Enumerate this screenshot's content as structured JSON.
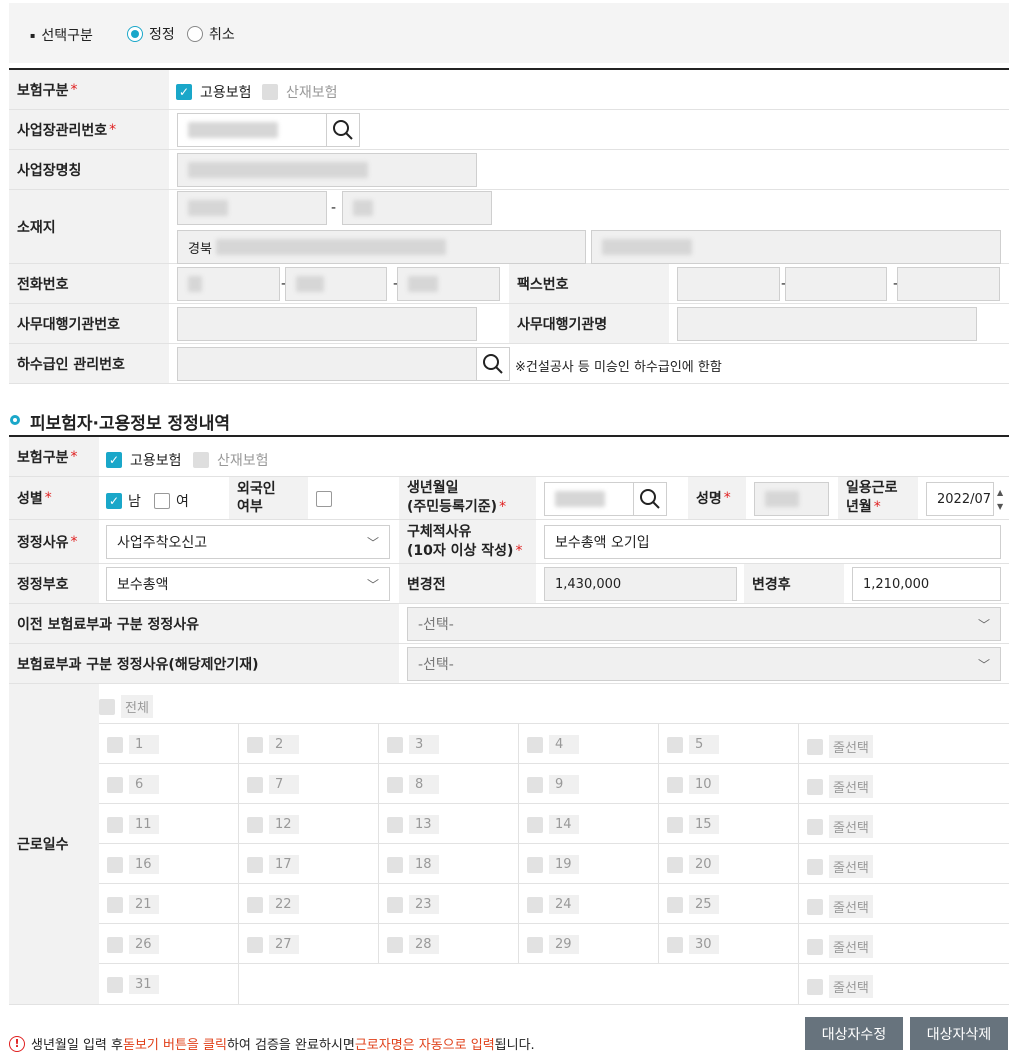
{
  "top": {
    "label": "선택구분",
    "options": [
      "정정",
      "취소"
    ],
    "selected": "정정"
  },
  "workplace": {
    "ins_type_label": "보험구분",
    "ins_options": [
      "고용보험",
      "산재보험"
    ],
    "mgmt_no_label": "사업장관리번호",
    "name_label": "사업장명칭",
    "addr_label": "소재지",
    "addr_prefix": "경북",
    "phone_label": "전화번호",
    "fax_label": "팩스번호",
    "agency_no_label": "사무대행기관번호",
    "agency_name_label": "사무대행기관명",
    "sub_no_label": "하수급인 관리번호",
    "sub_note": "※건설공사 등 미승인 하수급인에 한함"
  },
  "section_title": "피보험자·고용정보 정정내역",
  "insured": {
    "ins_type_label": "보험구분",
    "ins_options": [
      "고용보험",
      "산재보험"
    ],
    "gender_label": "성별",
    "gender_options": [
      "남",
      "여"
    ],
    "foreign_label": "외국인\n여부",
    "birth_label_1": "생년월일",
    "birth_label_2": "(주민등록기준)",
    "name_label": "성명",
    "daywork_label_1": "일용근로",
    "daywork_label_2": "년월",
    "daywork_value": "2022/07",
    "reason_label": "정정사유",
    "reason_value": "사업주착오신고",
    "detail_label_1": "구체적사유",
    "detail_label_2": "(10자 이상 작성)",
    "detail_value": "보수총액 오기입",
    "part_label": "정정부호",
    "part_value": "보수총액",
    "before_label": "변경전",
    "before_value": "1,430,000",
    "after_label": "변경후",
    "after_value": "1,210,000",
    "prev_reason_label": "이전 보험료부과 구분 정정사유",
    "prev_reason_value": "-선택-",
    "fee_reason_label": "보험료부과 구분 정정사유(해당제안기재)",
    "fee_reason_value": "-선택-",
    "workdays_label": "근로일수",
    "all_label": "전체",
    "row_select_label": "줄선택",
    "days": [
      [
        "1",
        "2",
        "3",
        "4",
        "5"
      ],
      [
        "6",
        "7",
        "8",
        "9",
        "10"
      ],
      [
        "11",
        "12",
        "13",
        "14",
        "15"
      ],
      [
        "16",
        "17",
        "18",
        "19",
        "20"
      ],
      [
        "21",
        "22",
        "23",
        "24",
        "25"
      ],
      [
        "26",
        "27",
        "28",
        "29",
        "30"
      ],
      [
        "31"
      ]
    ]
  },
  "footer": {
    "note_1": "생년월일 입력 후 ",
    "note_2": "돋보기 버튼을 클릭",
    "note_3": "하여 검증을 완료하시면 ",
    "note_4": "근로자명은 자동으로 입력",
    "note_5": "됩니다.",
    "btn_edit": "대상자수정",
    "btn_delete": "대상자삭제"
  },
  "colors": {
    "accent": "#1aa7c9",
    "required": "#e02020",
    "note": "#e0401a",
    "button": "#67737d"
  }
}
